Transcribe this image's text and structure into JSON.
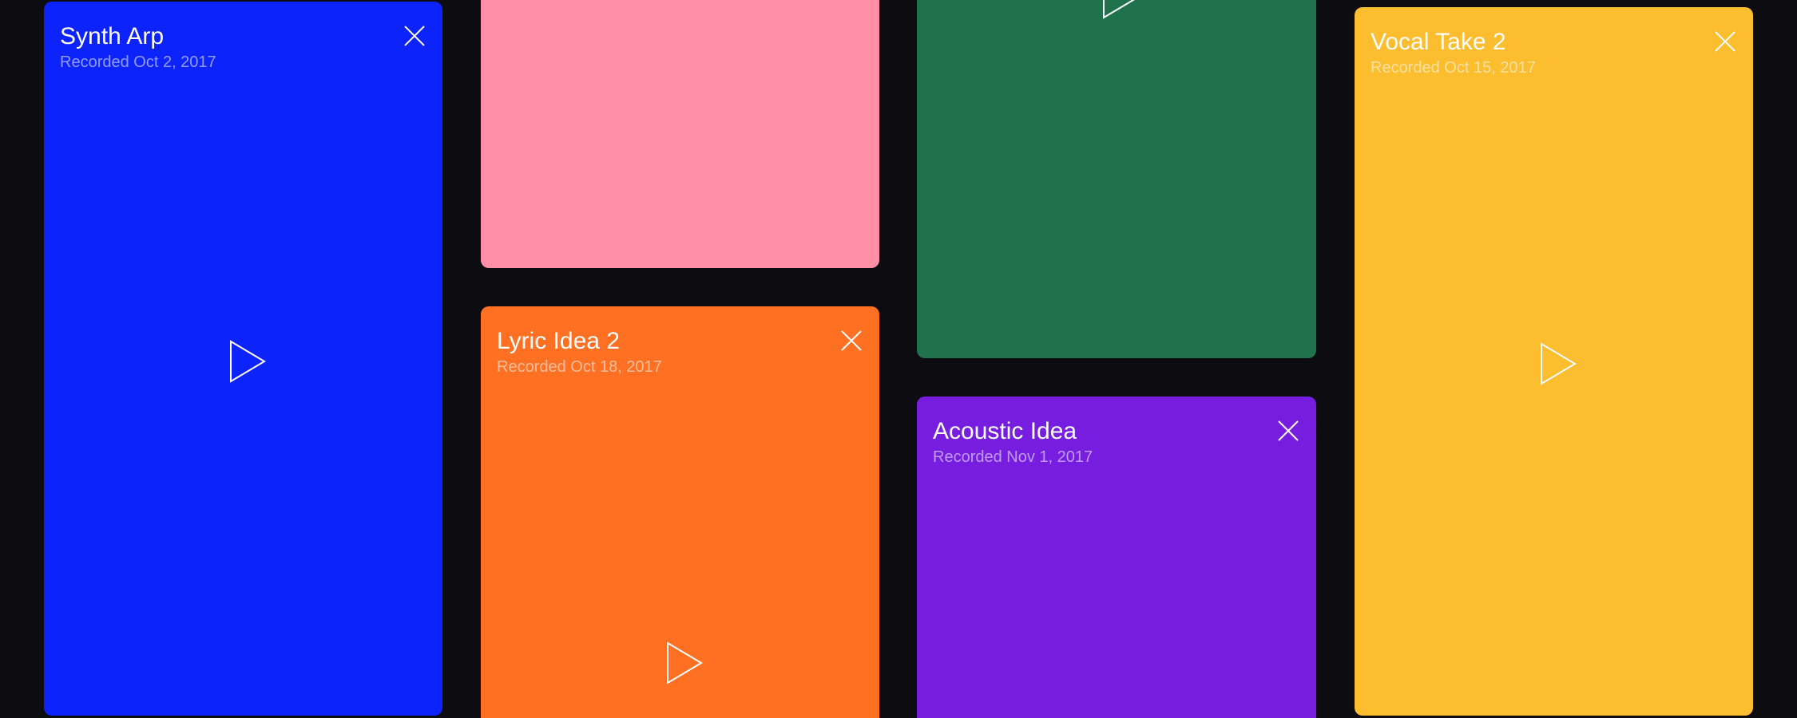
{
  "cards": [
    {
      "id": "synth-arp",
      "title": "Synth Arp",
      "subtitle": "Recorded Oct 2, 2017",
      "color": "#0d23fb",
      "icons": [
        "close-icon",
        "play-icon"
      ]
    },
    {
      "id": "pink",
      "title": "",
      "subtitle": "",
      "color": "#ff8fa7",
      "icons": []
    },
    {
      "id": "lyric-idea-2",
      "title": "Lyric Idea 2",
      "subtitle": "Recorded Oct 18, 2017",
      "color": "#ff7023",
      "icons": [
        "close-icon",
        "play-icon"
      ]
    },
    {
      "id": "green",
      "title": "",
      "subtitle": "",
      "color": "#1f724c",
      "icons": [
        "play-icon"
      ]
    },
    {
      "id": "acoustic-idea",
      "title": "Acoustic Idea",
      "subtitle": "Recorded Nov 1, 2017",
      "color": "#761ddf",
      "icons": [
        "close-icon"
      ]
    },
    {
      "id": "vocal-take-2",
      "title": "Vocal Take 2",
      "subtitle": "Recorded Oct 15, 2017",
      "color": "#fcbd2f",
      "icons": [
        "close-icon",
        "play-icon"
      ]
    }
  ],
  "background_color": "#0d0c11"
}
